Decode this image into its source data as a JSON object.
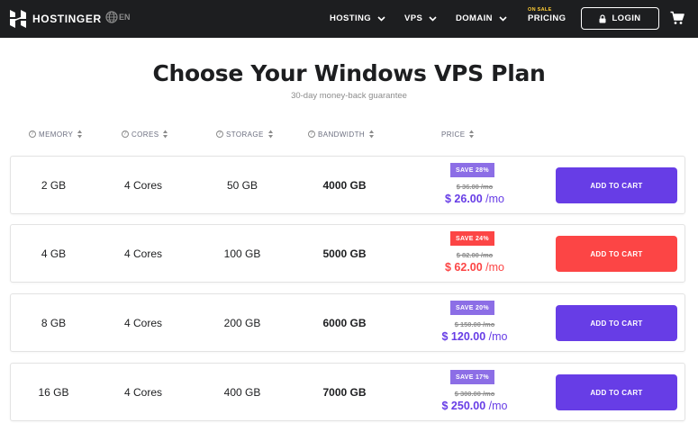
{
  "nav": {
    "brand": "HOSTINGER",
    "language": "EN",
    "items": [
      {
        "label": "HOSTING"
      },
      {
        "label": "VPS"
      },
      {
        "label": "DOMAIN"
      }
    ],
    "pricing": {
      "badge": "ON SALE",
      "label": "PRICING"
    },
    "login": "LOGIN"
  },
  "header": {
    "title": "Choose Your Windows VPS Plan",
    "subtitle": "30-day money-back guarantee"
  },
  "columns": {
    "memory": "MEMORY",
    "cores": "CORES",
    "storage": "STORAGE",
    "bandwidth": "BANDWIDTH",
    "price": "PRICE"
  },
  "plans": [
    {
      "memory": "2 GB",
      "cores": "4 Cores",
      "storage": "50 GB",
      "bandwidth": "4000 GB",
      "badge": "SAVE 28%",
      "old_price": "$ 36.00 /mo",
      "price": "$ 26.00",
      "per": " /mo",
      "cta": "ADD TO CART",
      "accent": "#673de6"
    },
    {
      "memory": "4 GB",
      "cores": "4 Cores",
      "storage": "100 GB",
      "bandwidth": "5000 GB",
      "badge": "SAVE 24%",
      "old_price": "$ 82.00 /mo",
      "price": "$ 62.00",
      "per": " /mo",
      "cta": "ADD TO CART",
      "accent": "#fc5185"
    },
    {
      "memory": "8 GB",
      "cores": "4 Cores",
      "storage": "200 GB",
      "bandwidth": "6000 GB",
      "badge": "SAVE 20%",
      "old_price": "$ 150.00 /mo",
      "price": "$ 120.00",
      "per": " /mo",
      "cta": "ADD TO CART",
      "accent": "#673de6"
    },
    {
      "memory": "16 GB",
      "cores": "4 Cores",
      "storage": "400 GB",
      "bandwidth": "7000 GB",
      "badge": "SAVE 17%",
      "old_price": "$ 300.00 /mo",
      "price": "$ 250.00",
      "per": " /mo",
      "cta": "ADD TO CART",
      "accent": "#673de6"
    }
  ],
  "colors": {
    "nav_bg": "#1d1e20",
    "purple": "#673de6",
    "purple_badge": "#8c6ee6",
    "red": "#fc4545",
    "on_sale": "#ffcd35"
  }
}
